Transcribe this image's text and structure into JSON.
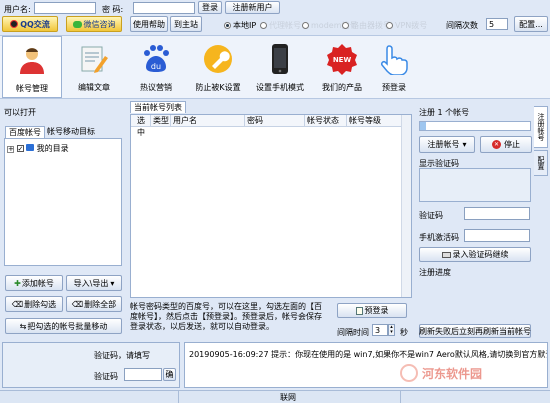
{
  "login": {
    "user_label": "用户名:",
    "pass_label": "密  码:",
    "login_btn": "登录",
    "register_btn": "注册新用户",
    "qq_btn": "QQ交流",
    "wechat_btn": "微信咨询",
    "help_btn": "使用帮助",
    "home_btn": "到主站",
    "local_ip": "本地IP",
    "opt_proxy": "代理帐号",
    "opt_modem": "modem拨号",
    "opt_router": "路由器拨号",
    "opt_vpn": "VPN拨号",
    "interval_label": "间隔次数",
    "interval_value": "5",
    "config_btn": "配置..."
  },
  "toolbar": {
    "items": [
      {
        "label": "帐号管理",
        "icon": "account-manage-icon"
      },
      {
        "label": "编辑文章",
        "icon": "edit-article-icon"
      },
      {
        "label": "热议营销",
        "icon": "baidu-icon"
      },
      {
        "label": "防止被K设置",
        "icon": "wrench-icon"
      },
      {
        "label": "设置手机模式",
        "icon": "phone-icon"
      },
      {
        "label": "我们的产品",
        "icon": "new-badge-icon"
      },
      {
        "label": "预登录",
        "icon": "hand-pointer-icon"
      }
    ]
  },
  "left": {
    "title": "可以打开",
    "tab_baidu": "百度帐号",
    "tab_move": "帐号移动目标",
    "tree_root": "我的目录",
    "add_btn": "添加帐号",
    "import_btn": "导入\\导出",
    "del_checked_btn": "删除勾选",
    "del_all_btn": "删除全部",
    "batch_move_btn": "把勾选的帐号批量移动"
  },
  "center": {
    "tab": "当前帐号列表",
    "columns": [
      "选中",
      "类型",
      "用户名",
      "密码",
      "帐号状态",
      "帐号等级"
    ],
    "info": "帐号密码类型的百度号，可以在这里，勾选左面的【百度帐号】，然后点击【预登录】。预登录后，帐号会保存登录状态，以后发送，就可以自动登录。",
    "prelogin_btn": "预登录",
    "interval_label": "间隔时间",
    "interval_value": "3",
    "interval_unit": "秒"
  },
  "right": {
    "register_title": "注册 1 个帐号",
    "register_btn": "注册帐号",
    "stop_btn": "停止",
    "show_captcha": "显示验证码",
    "captcha_label": "验证码",
    "phone_code_label": "手机激活码",
    "enter_captcha_btn": "录入验证码继续",
    "progress_label": "注册进度",
    "fail_btn": "刷新失败后立刻再刷新当前帐号",
    "side_tab_1": "注册帐号",
    "side_tab_2": "配置",
    "progress": 0.05
  },
  "bottom": {
    "captcha_prompt": "验证码，请填写",
    "captcha_label": "验证码",
    "confirm_btn": "确",
    "log": "20190905-16:09:27  提示：你现在使用的是 win7,如果你不是win7 Aero默认风格,请切换到官方默认主题,如果已经是默认主题",
    "status_mid": "联网"
  },
  "watermark": "河东软件园"
}
